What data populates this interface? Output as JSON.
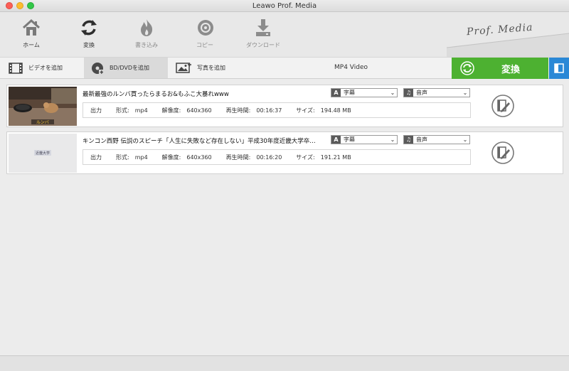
{
  "window": {
    "title": "Leawo Prof. Media"
  },
  "toolbar": {
    "items": [
      {
        "label": "ホーム",
        "icon": "home-icon"
      },
      {
        "label": "変換",
        "icon": "convert-icon"
      },
      {
        "label": "書き込み",
        "icon": "burn-icon"
      },
      {
        "label": "コピー",
        "icon": "copy-disc-icon"
      },
      {
        "label": "ダウンロード",
        "icon": "download-icon"
      }
    ],
    "brand": "Prof. Media"
  },
  "tabs": [
    {
      "label": "ビデオを追加",
      "icon": "film-icon"
    },
    {
      "label": "BD/DVDを追加",
      "icon": "disc-add-icon"
    },
    {
      "label": "写真を追加",
      "icon": "photo-add-icon"
    }
  ],
  "output_format": "MP4 Video",
  "convert_button": {
    "label": "変換"
  },
  "colors": {
    "convert_green": "#4db131",
    "side_blue": "#2a88d6"
  },
  "files": [
    {
      "title": "最新最強のルンバ買ったらまるお&もふこ大暴れwww",
      "subtitle_option": "字幕",
      "audio_option": "音声",
      "info": {
        "output_label": "出力",
        "format_label": "形式:",
        "format": "mp4",
        "res_label": "解像度:",
        "resolution": "640x360",
        "dur_label": "再生時間:",
        "duration": "00:16:37",
        "size_label": "サイズ:",
        "size": "194.48 MB"
      },
      "thumb_caption": "ルンバ"
    },
    {
      "title": "キンコン西野 伝説のスピーチ「人生に失敗など存在しない」平成30年度近畿大学卒…",
      "subtitle_option": "字幕",
      "audio_option": "音声",
      "info": {
        "output_label": "出力",
        "format_label": "形式:",
        "format": "mp4",
        "res_label": "解像度:",
        "resolution": "640x360",
        "dur_label": "再生時間:",
        "duration": "00:16:20",
        "size_label": "サイズ:",
        "size": "191.21 MB"
      },
      "thumb_caption": "近畿大学"
    }
  ]
}
